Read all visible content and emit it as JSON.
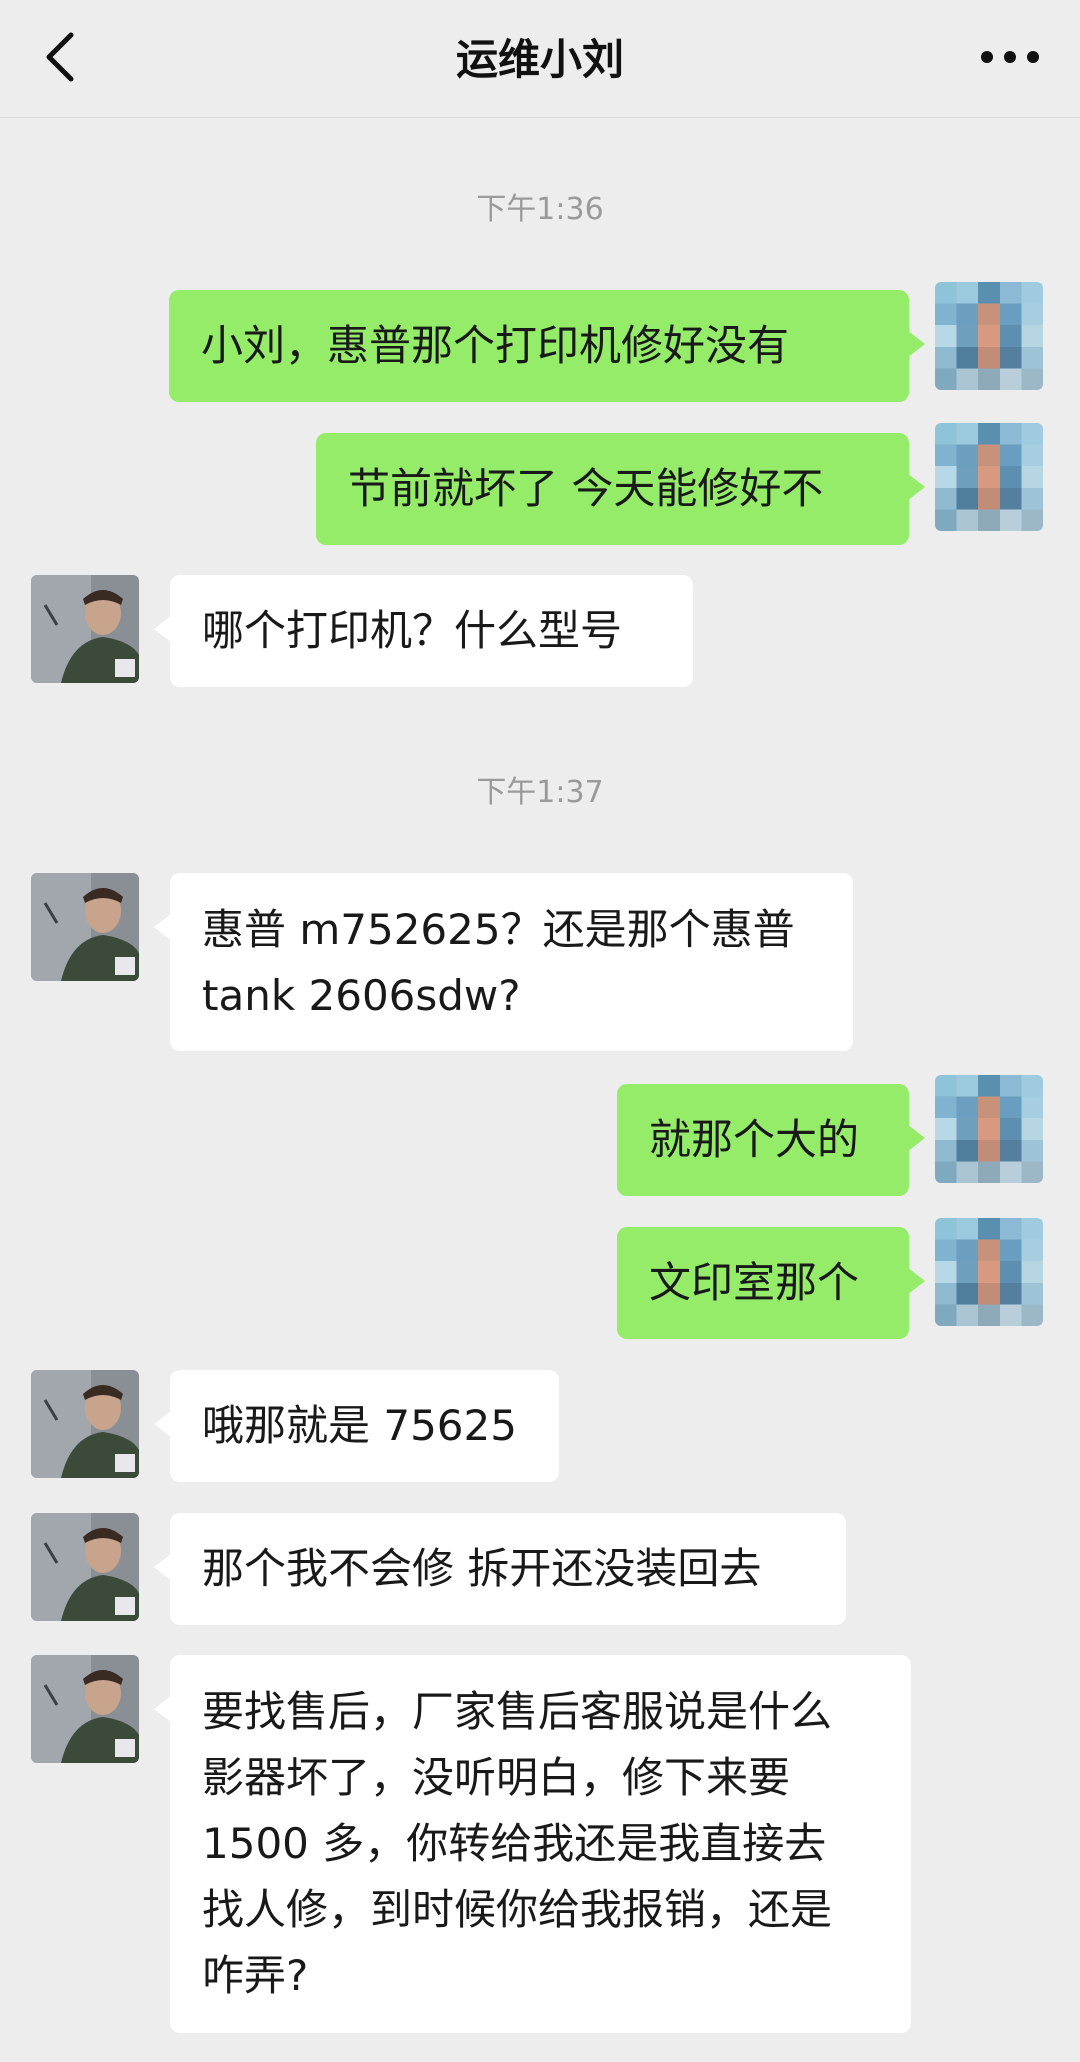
{
  "header": {
    "title": "运维小刘",
    "back_icon": "chevron-left-icon",
    "more_icon": "more-dots-icon"
  },
  "timestamps": [
    "下午1:36",
    "下午1:37"
  ],
  "messages": [
    {
      "sender": "me",
      "text": "小刘，惠普那个打印机修好没有"
    },
    {
      "sender": "me",
      "text": "节前就坏了 今天能修好不"
    },
    {
      "sender": "other",
      "text": "哪个打印机？什么型号"
    },
    {
      "sender": "other",
      "text": "惠普 m752625？还是那个惠普\ntank 2606sdw?"
    },
    {
      "sender": "me",
      "text": "就那个大的"
    },
    {
      "sender": "me",
      "text": "文印室那个"
    },
    {
      "sender": "other",
      "text": "哦那就是 75625"
    },
    {
      "sender": "other",
      "text": "那个我不会修 拆开还没装回去"
    },
    {
      "sender": "other",
      "text": "要找售后，厂家售后客服说是什么\n影器坏了，没听明白，修下来要\n1500 多，你转给我还是我直接去\n找人修，到时候你给我报销，还是\n咋弄?"
    }
  ],
  "colors": {
    "background": "#ededed",
    "my_bubble": "#95ec69",
    "their_bubble": "#ffffff",
    "timestamp": "#9a9a9a"
  }
}
